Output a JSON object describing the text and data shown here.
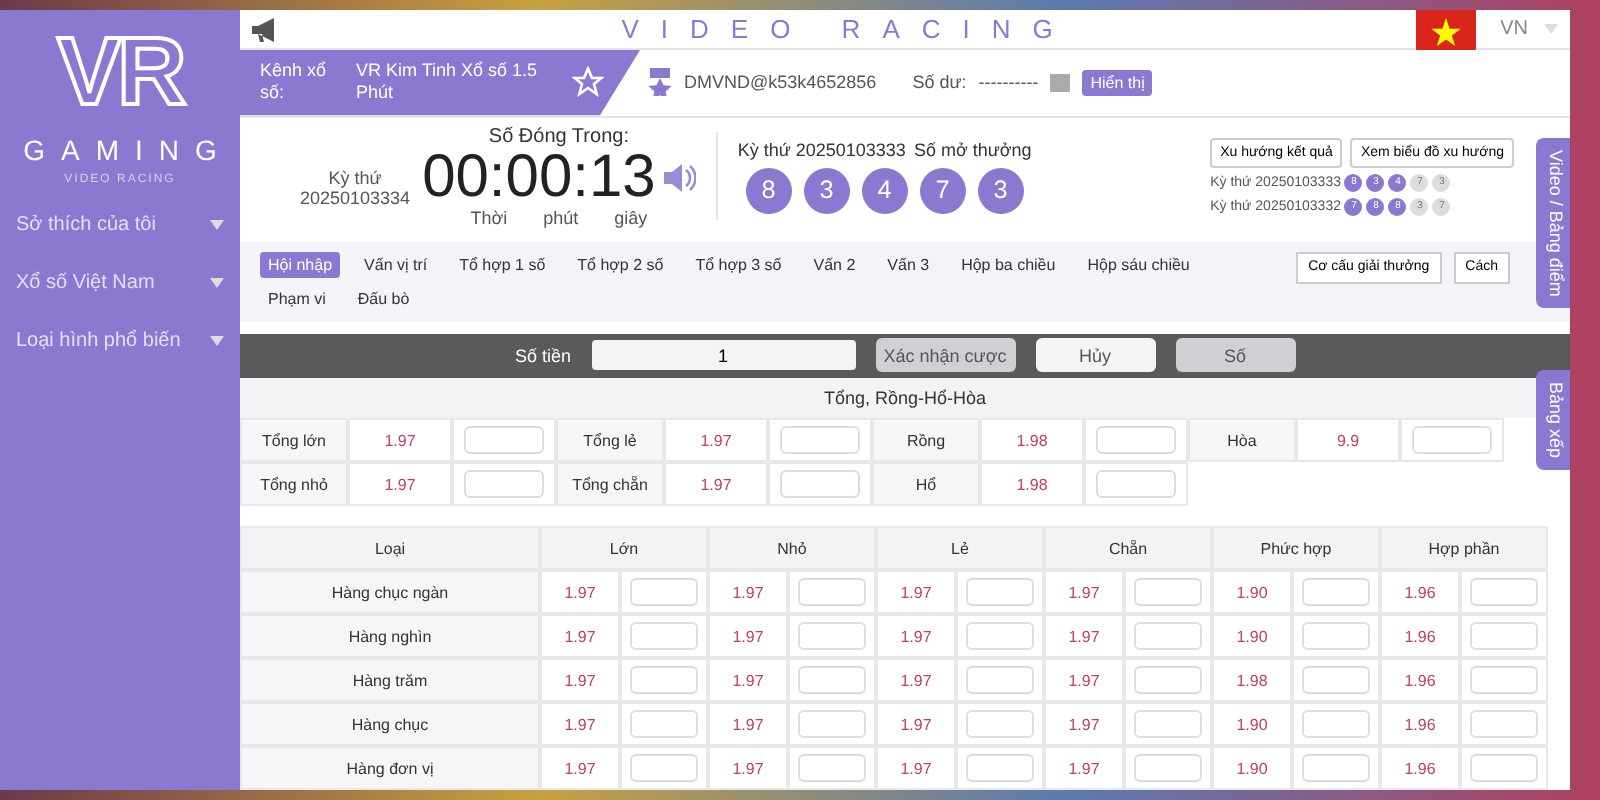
{
  "sidebar": {
    "logo": "VR",
    "brand": "GAMING",
    "tagline": "VIDEO RACING",
    "menu": [
      "Sở thích của tôi",
      "Xổ số Việt Nam",
      "Loại hình phổ biến"
    ]
  },
  "header": {
    "title": "VIDEO RACING",
    "language": "VN"
  },
  "channel": {
    "label": "Kênh xổ số:",
    "name": "VR Kim Tinh Xổ số 1.5 Phút"
  },
  "account": {
    "user": "DMVND@k53k4652856",
    "balance_label": "Số dư:",
    "balance": "----------",
    "show_button": "Hiển thị"
  },
  "countdown": {
    "period_label": "Kỳ thứ",
    "period": "20250103334",
    "title": "Số Đóng Trong:",
    "time": "00:00:13",
    "units": [
      "Thời",
      "phút",
      "giây"
    ]
  },
  "result": {
    "heading": "Kỳ thứ 20250103333",
    "label": "Số mở thưởng",
    "balls": [
      "8",
      "3",
      "4",
      "7",
      "3"
    ]
  },
  "history": {
    "buttons": [
      "Xu hướng kết quả",
      "Xem biểu đồ xu hướng"
    ],
    "rows": [
      {
        "label": "Kỳ thứ 20250103333",
        "balls": [
          {
            "value": "8",
            "highlighted": true
          },
          {
            "value": "3",
            "highlighted": true
          },
          {
            "value": "4",
            "highlighted": true
          },
          {
            "value": "7",
            "highlighted": false
          },
          {
            "value": "3",
            "highlighted": false
          }
        ]
      },
      {
        "label": "Kỳ thứ 20250103332",
        "balls": [
          {
            "value": "7",
            "highlighted": true
          },
          {
            "value": "8",
            "highlighted": true
          },
          {
            "value": "8",
            "highlighted": true
          },
          {
            "value": "3",
            "highlighted": false
          },
          {
            "value": "7",
            "highlighted": false
          }
        ]
      }
    ]
  },
  "play_tabs": [
    {
      "label": "Hội nhập",
      "selected": true
    },
    {
      "label": "Vấn vị trí",
      "selected": false
    },
    {
      "label": "Tổ hợp 1 số",
      "selected": false
    },
    {
      "label": "Tổ hợp 2 số",
      "selected": false
    },
    {
      "label": "Tổ hợp 3 số",
      "selected": false
    },
    {
      "label": "Vấn 2",
      "selected": false
    },
    {
      "label": "Vấn 3",
      "selected": false
    },
    {
      "label": "Hộp ba chiều",
      "selected": false
    },
    {
      "label": "Hộp sáu chiều",
      "selected": false
    },
    {
      "label": "Phạm vi",
      "selected": false
    },
    {
      "label": "Đấu bò",
      "selected": false
    }
  ],
  "tools": [
    "Cơ cấu giải thưởng",
    "Cách"
  ],
  "bet_bar": {
    "amount_label": "Số tiền",
    "amount": "1",
    "buttons": [
      {
        "label": "Xác nhận cược",
        "kind": "confirm"
      },
      {
        "label": "Hủy",
        "kind": "cancel"
      },
      {
        "label": "Số",
        "kind": "number"
      }
    ]
  },
  "sum_section": {
    "title": "Tổng, Rồng-Hổ-Hòa",
    "rows": [
      [
        {
          "label": "Tổng lớn",
          "odds": "1.97"
        },
        {
          "label": "Tổng lẻ",
          "odds": "1.97"
        },
        {
          "label": "Rồng",
          "odds": "1.98"
        },
        {
          "label": "Hòa",
          "odds": "9.9"
        }
      ],
      [
        {
          "label": "Tổng nhỏ",
          "odds": "1.97"
        },
        {
          "label": "Tổng chẵn",
          "odds": "1.97"
        },
        {
          "label": "Hổ",
          "odds": "1.98"
        }
      ]
    ]
  },
  "table": {
    "columns": [
      "Loại",
      "Lớn",
      "Nhỏ",
      "Lẻ",
      "Chẵn",
      "Phức hợp",
      "Hợp phần"
    ],
    "rows": [
      {
        "name": "Hàng chục ngàn",
        "odds": [
          "1.97",
          "1.97",
          "1.97",
          "1.97",
          "1.90",
          "1.96"
        ]
      },
      {
        "name": "Hàng nghìn",
        "odds": [
          "1.97",
          "1.97",
          "1.97",
          "1.97",
          "1.90",
          "1.96"
        ]
      },
      {
        "name": "Hàng trăm",
        "odds": [
          "1.97",
          "1.97",
          "1.97",
          "1.97",
          "1.98",
          "1.96"
        ]
      },
      {
        "name": "Hàng chục",
        "odds": [
          "1.97",
          "1.97",
          "1.97",
          "1.97",
          "1.90",
          "1.96"
        ]
      },
      {
        "name": "Hàng đơn vị",
        "odds": [
          "1.97",
          "1.97",
          "1.97",
          "1.97",
          "1.90",
          "1.96"
        ]
      }
    ]
  },
  "side_tabs": [
    "Video / Bảng điểm",
    "Bảng xếp"
  ]
}
